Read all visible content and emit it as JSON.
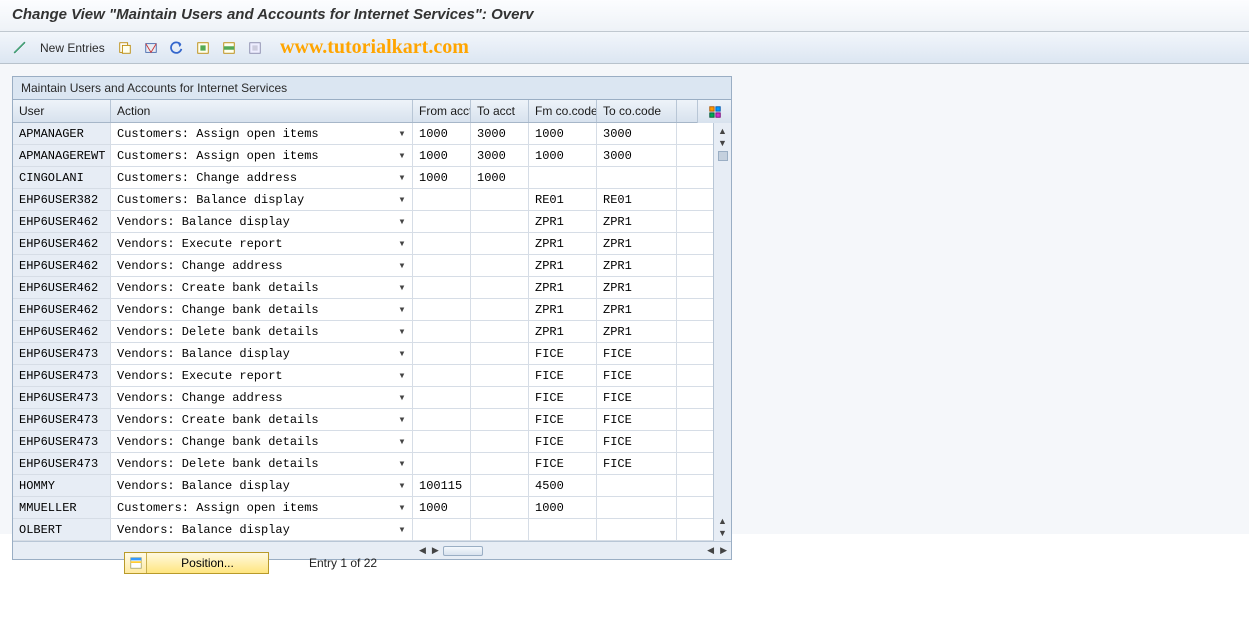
{
  "title": "Change View \"Maintain Users and Accounts for Internet Services\": Overv",
  "toolbar": {
    "new_entries": "New Entries"
  },
  "watermark": "www.tutorialkart.com",
  "grid": {
    "title": "Maintain Users and Accounts for Internet Services",
    "headers": {
      "user": "User",
      "action": "Action",
      "from_acct": "From acct",
      "to_acct": "To acct",
      "fm_cocode": "Fm co.code",
      "to_cocode": "To co.code"
    },
    "rows": [
      {
        "user": "APMANAGER",
        "action": "Customers: Assign open items",
        "from": "1000",
        "to": "3000",
        "fmcc": "1000",
        "tocc": "3000"
      },
      {
        "user": "APMANAGEREWT",
        "action": "Customers: Assign open items",
        "from": "1000",
        "to": "3000",
        "fmcc": "1000",
        "tocc": "3000"
      },
      {
        "user": "CINGOLANI",
        "action": "Customers: Change address",
        "from": "1000",
        "to": "1000",
        "fmcc": "",
        "tocc": ""
      },
      {
        "user": "EHP6USER382",
        "action": "Customers: Balance display",
        "from": "",
        "to": "",
        "fmcc": "RE01",
        "tocc": "RE01"
      },
      {
        "user": "EHP6USER462",
        "action": "Vendors: Balance display",
        "from": "",
        "to": "",
        "fmcc": "ZPR1",
        "tocc": "ZPR1"
      },
      {
        "user": "EHP6USER462",
        "action": "Vendors: Execute report",
        "from": "",
        "to": "",
        "fmcc": "ZPR1",
        "tocc": "ZPR1"
      },
      {
        "user": "EHP6USER462",
        "action": "Vendors: Change address",
        "from": "",
        "to": "",
        "fmcc": "ZPR1",
        "tocc": "ZPR1"
      },
      {
        "user": "EHP6USER462",
        "action": "Vendors: Create bank details",
        "from": "",
        "to": "",
        "fmcc": "ZPR1",
        "tocc": "ZPR1"
      },
      {
        "user": "EHP6USER462",
        "action": "Vendors: Change bank details",
        "from": "",
        "to": "",
        "fmcc": "ZPR1",
        "tocc": "ZPR1"
      },
      {
        "user": "EHP6USER462",
        "action": "Vendors: Delete bank details",
        "from": "",
        "to": "",
        "fmcc": "ZPR1",
        "tocc": "ZPR1"
      },
      {
        "user": "EHP6USER473",
        "action": "Vendors: Balance display",
        "from": "",
        "to": "",
        "fmcc": "FICE",
        "tocc": "FICE"
      },
      {
        "user": "EHP6USER473",
        "action": "Vendors: Execute report",
        "from": "",
        "to": "",
        "fmcc": "FICE",
        "tocc": "FICE"
      },
      {
        "user": "EHP6USER473",
        "action": "Vendors: Change address",
        "from": "",
        "to": "",
        "fmcc": "FICE",
        "tocc": "FICE"
      },
      {
        "user": "EHP6USER473",
        "action": "Vendors: Create bank details",
        "from": "",
        "to": "",
        "fmcc": "FICE",
        "tocc": "FICE"
      },
      {
        "user": "EHP6USER473",
        "action": "Vendors: Change bank details",
        "from": "",
        "to": "",
        "fmcc": "FICE",
        "tocc": "FICE"
      },
      {
        "user": "EHP6USER473",
        "action": "Vendors: Delete bank details",
        "from": "",
        "to": "",
        "fmcc": "FICE",
        "tocc": "FICE"
      },
      {
        "user": "HOMMY",
        "action": "Vendors: Balance display",
        "from": "100115",
        "to": "",
        "fmcc": "4500",
        "tocc": ""
      },
      {
        "user": "MMUELLER",
        "action": "Customers: Assign open items",
        "from": "1000",
        "to": "",
        "fmcc": "1000",
        "tocc": ""
      },
      {
        "user": "OLBERT",
        "action": "Vendors: Balance display",
        "from": "",
        "to": "",
        "fmcc": "",
        "tocc": ""
      }
    ]
  },
  "footer": {
    "position_label": "Position...",
    "entry_text": "Entry 1 of 22"
  }
}
